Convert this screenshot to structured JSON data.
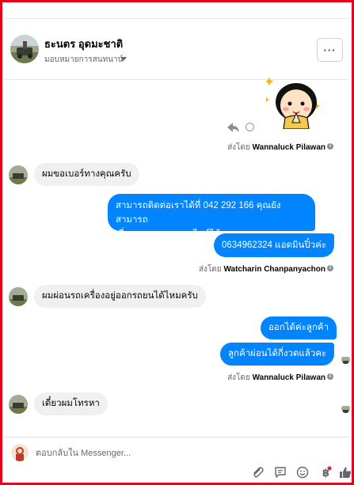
{
  "header": {
    "name": "ธะนตร อุดมะชาติ",
    "subtitle": "มอบหมายการสนทนาน์",
    "more_label": "···"
  },
  "messages": [
    {
      "side": "out-sticker",
      "sticker": "girl-praying-sticker"
    },
    {
      "side": "meta",
      "prefix": "ส่งโดย",
      "author": "Wannaluck Pilawan"
    },
    {
      "side": "in",
      "text": "ผมขอเบอร์ทางคุณครับ"
    },
    {
      "side": "out",
      "text_line1": "สามารถติดต่อเราได้ที่ 042 292 166 คุณยังสามารถ",
      "text_line2": "เยี่ยมชมเราทางออนไลน์ได้"
    },
    {
      "side": "out",
      "text": "0634962324 แอดมินปิ๋วค่ะ"
    },
    {
      "side": "meta",
      "prefix": "ส่งโดย",
      "author": "Watcharin Chanpanyachon"
    },
    {
      "side": "in",
      "text": "ผมผ่อนรถเครื่องอยู่ออกรถยนได้ไหมครับ"
    },
    {
      "side": "out",
      "text": "ออกได้ค่ะลูกค้า"
    },
    {
      "side": "out",
      "text": "ลูกค้าผ่อนได้กี่งวดแล้วคะ"
    },
    {
      "side": "meta",
      "prefix": "ส่งโดย",
      "author": "Wannaluck Pilawan"
    },
    {
      "side": "in",
      "text": "เดี๋ยวผมโทรหา"
    }
  ],
  "composer": {
    "placeholder": "ตอบกลับใน Messenger..."
  },
  "icons": [
    "paperclip-icon",
    "quick-reply-icon",
    "emoji-icon",
    "baht-icon",
    "thumbs-up-icon"
  ],
  "colors": {
    "outgoing_bubble": "#0084ff",
    "incoming_bubble": "#f0f0f0",
    "frame_border": "#e5001b"
  }
}
